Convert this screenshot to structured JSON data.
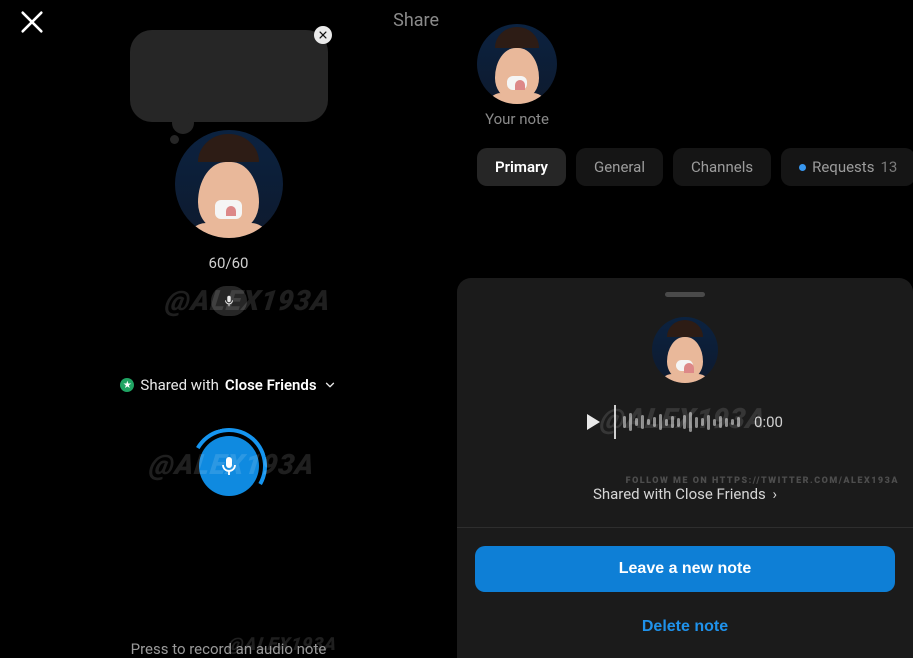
{
  "left": {
    "share_label": "Share",
    "counter": "60/60",
    "shared_prefix": "Shared with",
    "shared_audience": "Close Friends",
    "hint": "Press to record an audio note"
  },
  "right": {
    "your_note_label": "Your note",
    "tabs": [
      {
        "label": "Primary"
      },
      {
        "label": "General"
      },
      {
        "label": "Channels"
      },
      {
        "label": "Requests",
        "count": "13"
      }
    ],
    "sheet": {
      "time": "0:00",
      "shared_line": "Shared with Close Friends",
      "leave_label": "Leave a new note",
      "delete_label": "Delete note"
    }
  },
  "watermark": {
    "handle": "@ALEX193A",
    "follow": "FOLLOW ME ON HTTPS://TWITTER.COM/ALEX193A"
  }
}
